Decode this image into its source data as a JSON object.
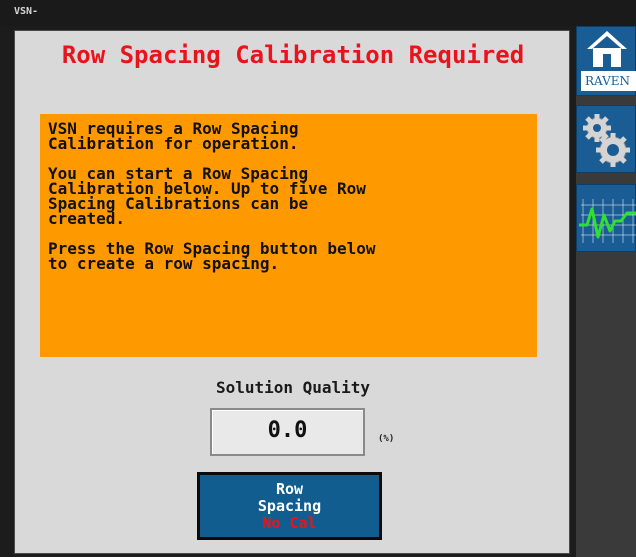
{
  "window": {
    "title": "VSN-"
  },
  "header": {
    "title": "Row Spacing Calibration Required"
  },
  "notice": {
    "paragraphs": [
      "VSN requires a Row Spacing\nCalibration for operation.",
      "You can start a Row Spacing\nCalibration below. Up to five Row\nSpacing Calibrations can be\ncreated.",
      "Press the Row Spacing button below\nto create a row spacing."
    ],
    "background": "#ff9900"
  },
  "solution_quality": {
    "label": "Solution Quality",
    "value": "0.0",
    "unit": "(%)"
  },
  "row_spacing_button": {
    "line1": "Row",
    "line2": "Spacing",
    "status": "No Cal"
  },
  "sidebar": {
    "items": [
      {
        "name": "home",
        "icon": "home-icon",
        "label": "RAVEN"
      },
      {
        "name": "settings",
        "icon": "gears-icon"
      },
      {
        "name": "diagnostics",
        "icon": "pulse-icon"
      }
    ]
  },
  "colors": {
    "title_red": "#e8141c",
    "button_blue": "#125d8f",
    "sidebar_blue": "#1a5d94"
  }
}
